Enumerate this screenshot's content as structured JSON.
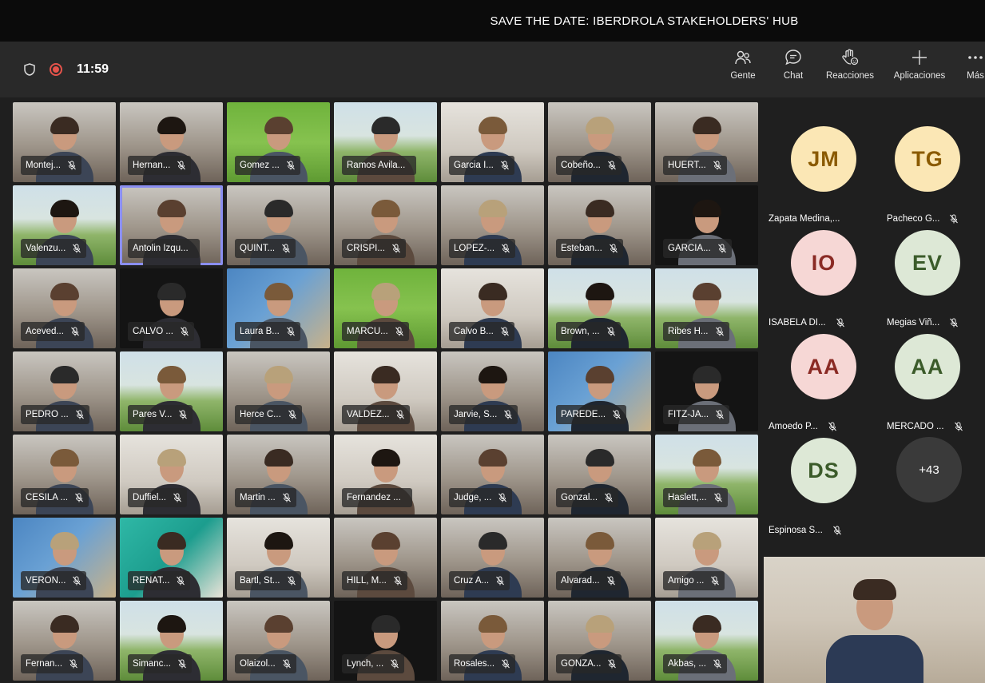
{
  "window": {
    "title": "SAVE THE DATE: IBERDROLA STAKEHOLDERS' HUB"
  },
  "toolbar": {
    "time": "11:59",
    "buttons": [
      {
        "label": "Gente",
        "icon": "people-icon"
      },
      {
        "label": "Chat",
        "icon": "chat-icon"
      },
      {
        "label": "Reacciones",
        "icon": "raise-hand-icon"
      },
      {
        "label": "Aplicaciones",
        "icon": "plus-icon"
      },
      {
        "label": "Más",
        "icon": "more-icon"
      }
    ]
  },
  "participants": [
    {
      "name": "Montej...",
      "bg": "office",
      "muted": true
    },
    {
      "name": "Hernan...",
      "bg": "office",
      "muted": true
    },
    {
      "name": "Gomez ...",
      "bg": "green",
      "muted": true
    },
    {
      "name": "Ramos Avila...",
      "bg": "land",
      "muted": false
    },
    {
      "name": "Garcia I...",
      "bg": "wall",
      "muted": true
    },
    {
      "name": "Cobeño...",
      "bg": "office",
      "muted": true
    },
    {
      "name": "HUERT...",
      "bg": "office",
      "muted": true
    },
    {
      "name": "Valenzu...",
      "bg": "land",
      "muted": true
    },
    {
      "name": "Antolin Izqu...",
      "bg": "office",
      "muted": false,
      "active": true
    },
    {
      "name": "QUINT...",
      "bg": "office",
      "muted": true
    },
    {
      "name": "CRISPI...",
      "bg": "office",
      "muted": true
    },
    {
      "name": "LOPEZ-...",
      "bg": "office",
      "muted": true
    },
    {
      "name": "Esteban...",
      "bg": "office",
      "muted": true
    },
    {
      "name": "GARCIA...",
      "bg": "dark",
      "muted": true
    },
    {
      "name": "Aceved...",
      "bg": "office",
      "muted": true
    },
    {
      "name": "CALVO ...",
      "bg": "dark",
      "muted": true
    },
    {
      "name": "Laura B...",
      "bg": "solar",
      "muted": true
    },
    {
      "name": "MARCU...",
      "bg": "green",
      "muted": true
    },
    {
      "name": "Calvo B...",
      "bg": "wall",
      "muted": true
    },
    {
      "name": "Brown, ...",
      "bg": "land",
      "muted": true
    },
    {
      "name": "Ribes H...",
      "bg": "land",
      "muted": true
    },
    {
      "name": "PEDRO ...",
      "bg": "office",
      "muted": true
    },
    {
      "name": "Pares V...",
      "bg": "land",
      "muted": true
    },
    {
      "name": "Herce C...",
      "bg": "office",
      "muted": true
    },
    {
      "name": "VALDEZ...",
      "bg": "wall",
      "muted": true
    },
    {
      "name": "Jarvie, S...",
      "bg": "office",
      "muted": true
    },
    {
      "name": "PAREDE...",
      "bg": "solar",
      "muted": true
    },
    {
      "name": "FITZ-JA...",
      "bg": "dark",
      "muted": true
    },
    {
      "name": "CESILA ...",
      "bg": "office",
      "muted": true
    },
    {
      "name": "Duffiel...",
      "bg": "wall",
      "muted": true
    },
    {
      "name": "Martin ...",
      "bg": "office",
      "muted": true
    },
    {
      "name": "Fernandez ...",
      "bg": "wall",
      "muted": false
    },
    {
      "name": "Judge, ...",
      "bg": "office",
      "muted": true
    },
    {
      "name": "Gonzal...",
      "bg": "office",
      "muted": true
    },
    {
      "name": "Haslett,...",
      "bg": "land",
      "muted": true
    },
    {
      "name": "VERON...",
      "bg": "solar",
      "muted": true
    },
    {
      "name": "RENAT...",
      "bg": "teal",
      "muted": true
    },
    {
      "name": "Bartl, St...",
      "bg": "wall",
      "muted": true
    },
    {
      "name": "HILL, M...",
      "bg": "office",
      "muted": true
    },
    {
      "name": "Cruz A...",
      "bg": "office",
      "muted": true
    },
    {
      "name": "Alvarad...",
      "bg": "office",
      "muted": true
    },
    {
      "name": "Amigo ...",
      "bg": "wall",
      "muted": true
    },
    {
      "name": "Fernan...",
      "bg": "office",
      "muted": true
    },
    {
      "name": "Simanc...",
      "bg": "land",
      "muted": true
    },
    {
      "name": "Olaizol...",
      "bg": "office",
      "muted": true
    },
    {
      "name": "Lynch, ...",
      "bg": "dark",
      "muted": true
    },
    {
      "name": "Rosales...",
      "bg": "office",
      "muted": true
    },
    {
      "name": "GONZA...",
      "bg": "office",
      "muted": true
    },
    {
      "name": "Akbas, ...",
      "bg": "land",
      "muted": true
    }
  ],
  "avatars": [
    {
      "initials": "JM",
      "name": "Zapata Medina,...",
      "color": "#fbe7b5",
      "text_color": "#8a5a00",
      "muted": false
    },
    {
      "initials": "TG",
      "name": "Pacheco G...",
      "color": "#fbe7b5",
      "text_color": "#8a5a00",
      "muted": true
    },
    {
      "initials": "IO",
      "name": "ISABELA DI...",
      "color": "#f6d7d5",
      "text_color": "#8a2a24",
      "muted": true
    },
    {
      "initials": "EV",
      "name": "Megias Viñ...",
      "color": "#dde8d6",
      "text_color": "#3b5b2a",
      "muted": true
    },
    {
      "initials": "AA",
      "name": "Amoedo P...",
      "color": "#f6d7d5",
      "text_color": "#8a2a24",
      "muted": true
    },
    {
      "initials": "AA",
      "name": "MERCADO ...",
      "color": "#dde8d6",
      "text_color": "#3b5b2a",
      "muted": true
    },
    {
      "initials": "DS",
      "name": "Espinosa S...",
      "color": "#dde8d6",
      "text_color": "#3b5b2a",
      "muted": true
    }
  ],
  "overflow": {
    "label": "+43"
  }
}
